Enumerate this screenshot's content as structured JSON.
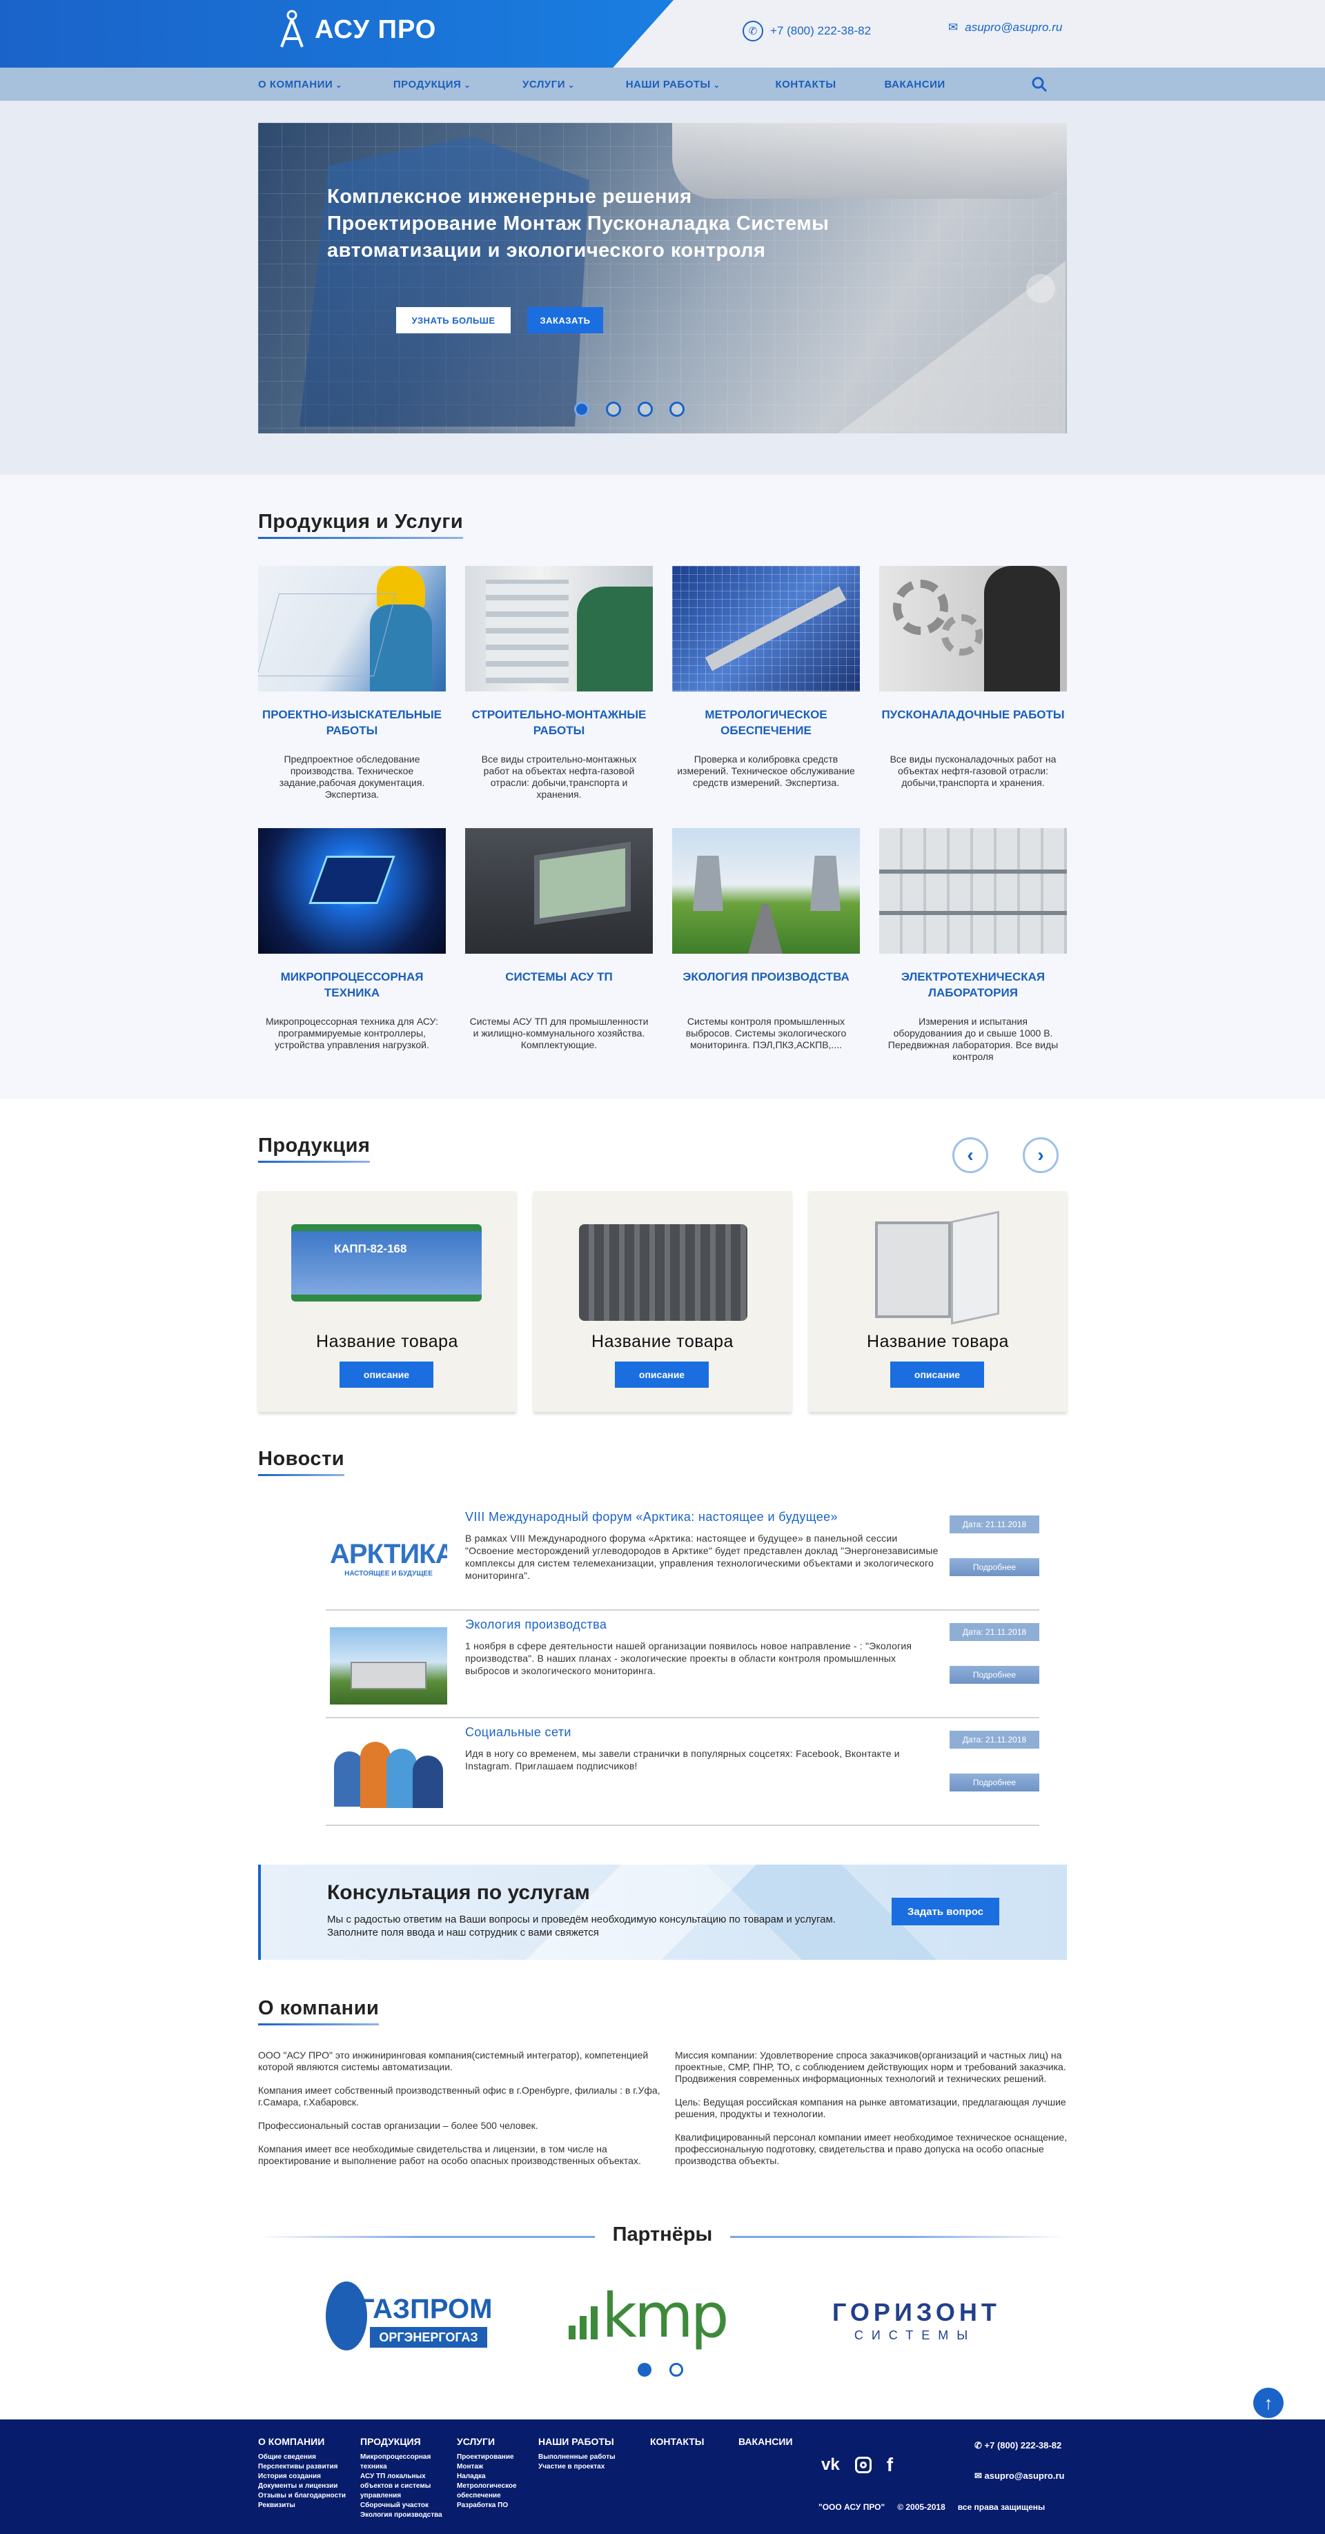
{
  "header": {
    "brand": "АСУ ПРО",
    "phone": "+7 (800) 222-38-82",
    "email": "asupro@asupro.ru"
  },
  "nav": {
    "items": [
      {
        "label": "О компании",
        "dropdown": true
      },
      {
        "label": "Продукция",
        "dropdown": true
      },
      {
        "label": "Услуги",
        "dropdown": true
      },
      {
        "label": "Наши работы",
        "dropdown": true
      },
      {
        "label": "Контакты",
        "dropdown": false
      },
      {
        "label": "Вакансии",
        "dropdown": false
      }
    ]
  },
  "hero": {
    "title": "Комплексное инженерные решения Проектирование Монтаж Пусконаладка Системы автоматизации и экологического контроля",
    "btn_more": "УЗНАТЬ БОЛЬШЕ",
    "btn_order": "ЗАКАЗАТЬ",
    "slides": 4,
    "active_slide": 1
  },
  "services": {
    "title": "Продукция и Услуги",
    "items": [
      {
        "title": "Проектно-изыскательные работы",
        "desc": "Предпроектное обследование производства. Техническое задание,рабочая документация. Экспертиза."
      },
      {
        "title": "Строительно-монтажные работы",
        "desc": "Все виды строительно-монтажных работ на объектах нефта-газовой отрасли: добычи,транспорта и хранения."
      },
      {
        "title": "Метрологическое обеспечение",
        "desc": "Проверка и колибровка средств измерений. Техническое обслуживание средств измерений. Экспертиза."
      },
      {
        "title": "Пусконаладочные работы",
        "desc": "Все виды пусконаладочных работ на объектах нефтя-газовой отрасли: добычи,транспорта и хранения."
      },
      {
        "title": "Микропроцессорная техника",
        "desc": "Микропроцессорная техника для АСУ: программируемые контроллеры, устройства управления нагрузкой."
      },
      {
        "title": "Системы АСУ ТП",
        "desc": "Системы АСУ ТП для промышленности и жилищно-коммунального хозяйства. Комплектующие."
      },
      {
        "title": "Экология производства",
        "desc": "Системы контроля промышленных выбросов. Системы экологического мониторинга. ПЭЛ,ПКЗ,АСКПВ,...."
      },
      {
        "title": "Электротехническая лаборатория",
        "desc": "Измерения и испытания оборудованиия до и свыше 1000 В. Передвижная лаборатория. Все виды контроля"
      }
    ]
  },
  "products": {
    "title": "Продукция",
    "device_label": "КАПП-82-168",
    "items": [
      {
        "name": "Название товара",
        "button": "описание"
      },
      {
        "name": "Название товара",
        "button": "описание"
      },
      {
        "name": "Название товара",
        "button": "описание"
      }
    ]
  },
  "news": {
    "title": "Новости",
    "arktika_logo": "АРКТИКА",
    "arktika_sub": "НАСТОЯЩЕЕ И БУДУЩЕЕ",
    "items": [
      {
        "title": "VIII Международный форум «Арктика: настоящее и будущее»",
        "text": "В рамках VIII Международного форума «Арктика: настоящее и будущее» в панельной сессии \"Освоение месторождений углеводородов в Арктике\" будет представлен доклад \"Энергонезависимые комплексы для систем телемеханизации, управления технологическими объектами и экологического мониторинга\".",
        "date": "Дата: 21.11.2018",
        "more": "Подробнее"
      },
      {
        "title": "Экология производства",
        "text": "1 ноября в сфере деятельности нашей организации появилось новое направление - : \"Экология производства\". В наших планах - экологические проекты в области контроля промышленных выбросов и экологического мониторинга.",
        "date": "Дата: 21.11.2018",
        "more": "Подробнее"
      },
      {
        "title": "Социальные сети",
        "text": "Идя в ногу со временем, мы завели странички в популярных соцсетях: Facebook, Вконтакте и Instagram. Приглашаем подписчиков!",
        "date": "Дата: 21.11.2018",
        "more": "Подробнее"
      }
    ]
  },
  "consult": {
    "title": "Консультация по услугам",
    "text": "Мы с радостью ответим на Ваши вопросы и проведём необходимую консультацию по товарам и услугам. Заполните поля ввода и наш сотрудник с вами свяжется",
    "button": "Задать вопрос"
  },
  "about": {
    "title": "О компании",
    "left": [
      "ООО \"АСУ ПРО\" это инжиниринговая компания(системный интегратор), компетенцией которой являются системы автоматизации.",
      "Компания имеет собственный производственный офис в г.Оренбурге, филиалы : в г.Уфа, г.Самара, г.Хабаровск.",
      "Профессиональный состав организации – более 500 человек.",
      "Компания имеет все необходимые свидетельства и лицензии, в том числе на проектирование и выполнение работ на особо опасных производственных объектах."
    ],
    "right": [
      "Миссия компании: Удовлетворение спроса заказчиков(организаций и частных лиц) на проектные, СМР, ПНР, ТО, с соблюдением действующих норм и требований заказчика. Продвижения современных информационных технологий и технических решений.",
      "Цель: Ведущая российская компания на рынке автоматизации, предлагающая лучшие решения, продукты и технологии.",
      "Квалифицированный персонал компании имеет необходимое техническое оснащение, профессиональную подготовку, свидетельства и право допуска на особо опасные производства объекты."
    ]
  },
  "partners": {
    "title": "Партнёры",
    "items": [
      {
        "name": "ГАЗПРОМ",
        "sub": "ОРГЭНЕРГОГАЗ"
      },
      {
        "name": "kmp"
      },
      {
        "name": "ГОРИЗОНТ",
        "sub": "СИСТЕМЫ"
      }
    ]
  },
  "footer": {
    "cols": [
      {
        "head": "О компании",
        "items": [
          "Общие сведения",
          "Перспективы развития",
          "История создания",
          "Документы и лицензии",
          "Отзывы и благодарности",
          "Реквизиты"
        ]
      },
      {
        "head": "Продукция",
        "items": [
          "Микропроцессорная техника",
          "АСУ ТП локальных объектов и системы управления",
          "Сборочный участок",
          "Экология производства"
        ]
      },
      {
        "head": "Услуги",
        "items": [
          "Проектирование",
          "Монтаж",
          "Наладка",
          "Метрологическое обеспечение",
          "Разработка ПО"
        ]
      },
      {
        "head": "Наши работы",
        "items": [
          "Выполненные работы",
          "Участие в проектах"
        ]
      },
      {
        "head": "Контакты",
        "items": []
      },
      {
        "head": "Вакансии",
        "items": []
      }
    ],
    "phone": "+7 (800) 222-38-82",
    "email": "asupro@asupro.ru",
    "company": "\"ООО АСУ ПРО\"",
    "years": "© 2005-2018",
    "rights": "все права защищены"
  },
  "colors": {
    "accent": "#1a63c9",
    "nav": "#a7c0db",
    "footer": "#071c6b"
  }
}
